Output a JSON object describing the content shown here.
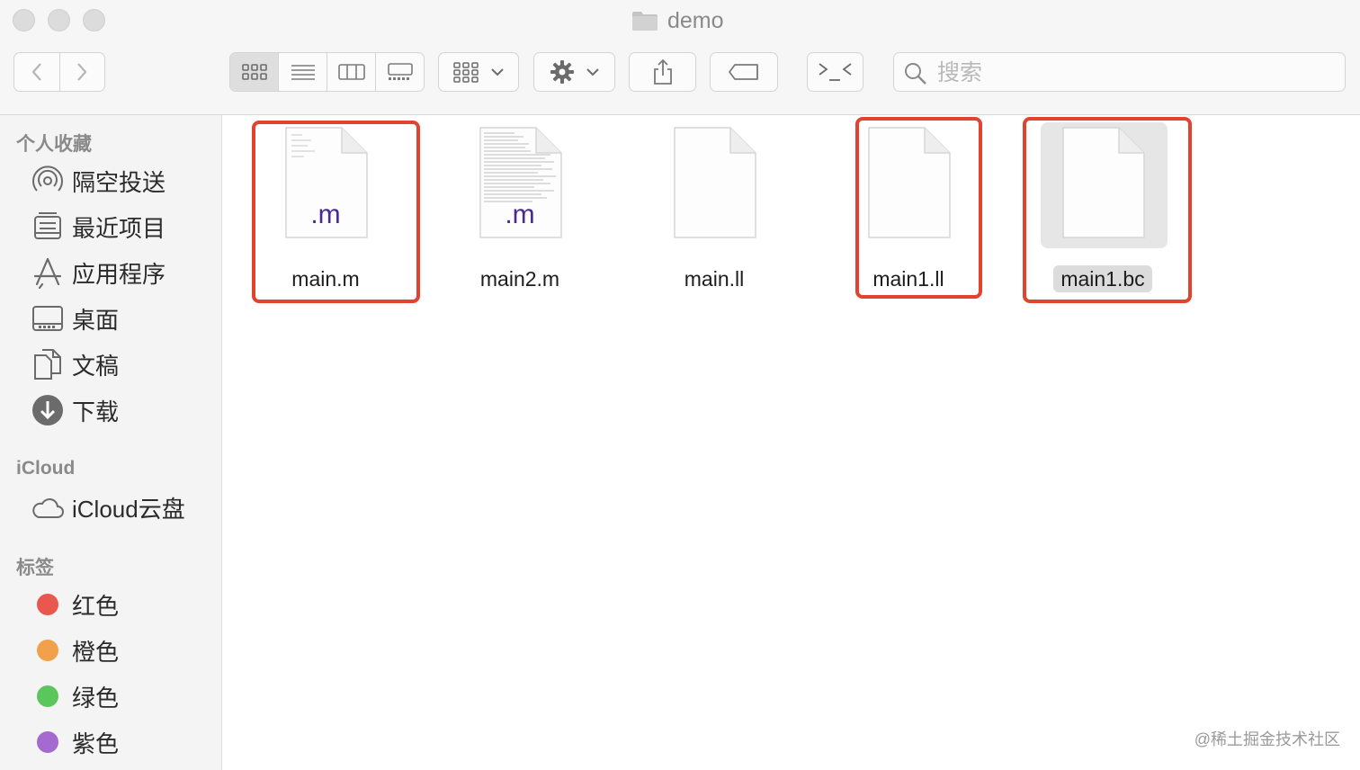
{
  "window": {
    "title": "demo"
  },
  "toolbar": {
    "search_placeholder": "搜索",
    "icons": [
      "chevron-left-icon",
      "chevron-right-icon",
      "icon-view-icon",
      "list-view-icon",
      "column-view-icon",
      "gallery-view-icon",
      "group-icon",
      "gear-icon",
      "share-icon",
      "tag-icon",
      "terminal-icon",
      "search-icon"
    ]
  },
  "sidebar": {
    "favorites_header": "个人收藏",
    "favorites": [
      {
        "label": "隔空投送",
        "icon": "airdrop-icon"
      },
      {
        "label": "最近项目",
        "icon": "recents-icon"
      },
      {
        "label": "应用程序",
        "icon": "applications-icon"
      },
      {
        "label": "桌面",
        "icon": "desktop-icon"
      },
      {
        "label": "文稿",
        "icon": "documents-icon"
      },
      {
        "label": "下载",
        "icon": "download-icon"
      }
    ],
    "icloud_header": "iCloud",
    "icloud_items": [
      {
        "label": "iCloud云盘",
        "icon": "cloud-icon"
      }
    ],
    "tags_header": "标签",
    "tags": [
      {
        "label": "红色",
        "color": "#e9574e"
      },
      {
        "label": "橙色",
        "color": "#f0a14a"
      },
      {
        "label": "绿色",
        "color": "#5bc65b"
      },
      {
        "label": "紫色",
        "color": "#a56ad0"
      }
    ]
  },
  "files": [
    {
      "name": "main.m",
      "badge": ".m",
      "preview": "text-light",
      "highlighted": true,
      "selected": false
    },
    {
      "name": "main2.m",
      "badge": ".m",
      "preview": "text-dense",
      "highlighted": false,
      "selected": false
    },
    {
      "name": "main.ll",
      "badge": "",
      "preview": "blank",
      "highlighted": false,
      "selected": false
    },
    {
      "name": "main1.ll",
      "badge": "",
      "preview": "blank",
      "highlighted": true,
      "selected": false
    },
    {
      "name": "main1.bc",
      "badge": "",
      "preview": "blank",
      "highlighted": true,
      "selected": true
    }
  ],
  "colors": {
    "highlight": "#e1432f",
    "badge": "#4a2a8f"
  },
  "watermark": "@稀土掘金技术社区"
}
